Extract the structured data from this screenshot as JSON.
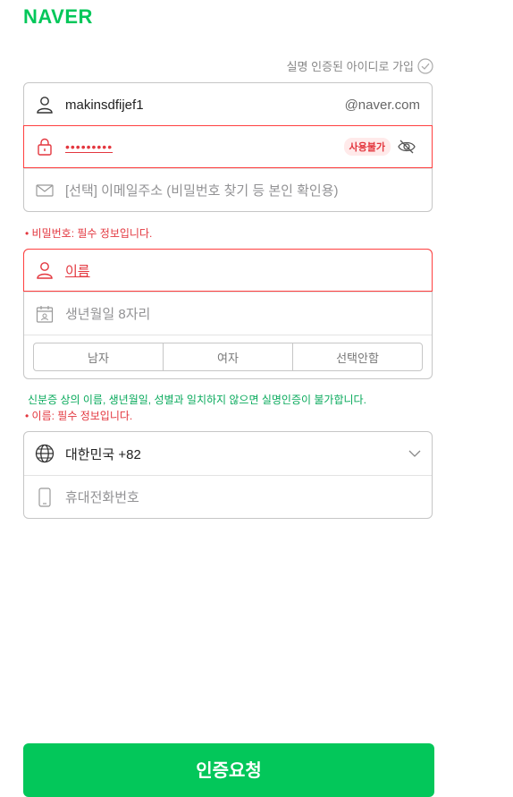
{
  "header": {
    "logo": "NAVER"
  },
  "verified_link": {
    "label": "실명 인증된 아이디로 가입"
  },
  "account": {
    "id_value": "makinsdfijef1",
    "id_suffix": "@naver.com",
    "password_masked": "•••••••••",
    "password_badge": "사용불가",
    "email_placeholder": "[선택] 이메일주소 (비밀번호 찾기 등 본인 확인용)"
  },
  "errors": {
    "password": "• 비밀번호: 필수 정보입니다.",
    "name_notice": "신분증 상의 이름, 생년월일, 성별과 일치하지 않으면 실명인증이 불가합니다.",
    "name": "• 이름: 필수 정보입니다."
  },
  "profile": {
    "name_placeholder": "이름",
    "birth_placeholder": "생년월일 8자리",
    "gender_options": [
      "남자",
      "여자",
      "선택안함"
    ]
  },
  "phone": {
    "country": "대한민국 +82",
    "phone_placeholder": "휴대전화번호"
  },
  "submit": {
    "label": "인증요청"
  }
}
